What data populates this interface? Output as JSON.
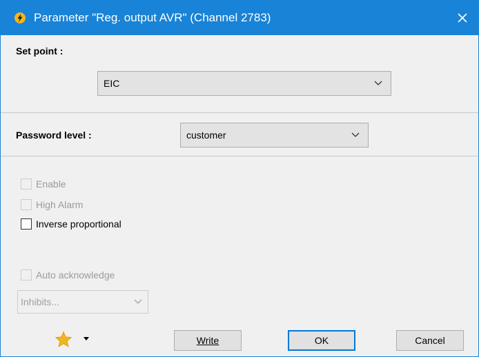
{
  "window": {
    "title": "Parameter \"Reg. output AVR\" (Channel 2783)"
  },
  "setpoint": {
    "label": "Set point :",
    "value": "EIC"
  },
  "password": {
    "label": "Password level :",
    "value": "customer"
  },
  "checkboxes": [
    {
      "label": "Enable",
      "checked": false,
      "enabled": false
    },
    {
      "label": "High Alarm",
      "checked": false,
      "enabled": false
    },
    {
      "label": "Inverse proportional",
      "checked": false,
      "enabled": true
    }
  ],
  "auto_ack": {
    "label": "Auto acknowledge",
    "checked": false,
    "enabled": false
  },
  "inhibits": {
    "value": "Inhibits..."
  },
  "buttons": {
    "write": "Write",
    "ok": "OK",
    "cancel": "Cancel"
  },
  "colors": {
    "titlebar": "#1883d7",
    "background": "#f0f0f0",
    "accent": "#0078d7",
    "star": "#f3b51c"
  },
  "icons": {
    "title": "lightning-icon",
    "close": "close-icon",
    "star": "star-icon",
    "dropdown": "chevron-down-icon"
  }
}
